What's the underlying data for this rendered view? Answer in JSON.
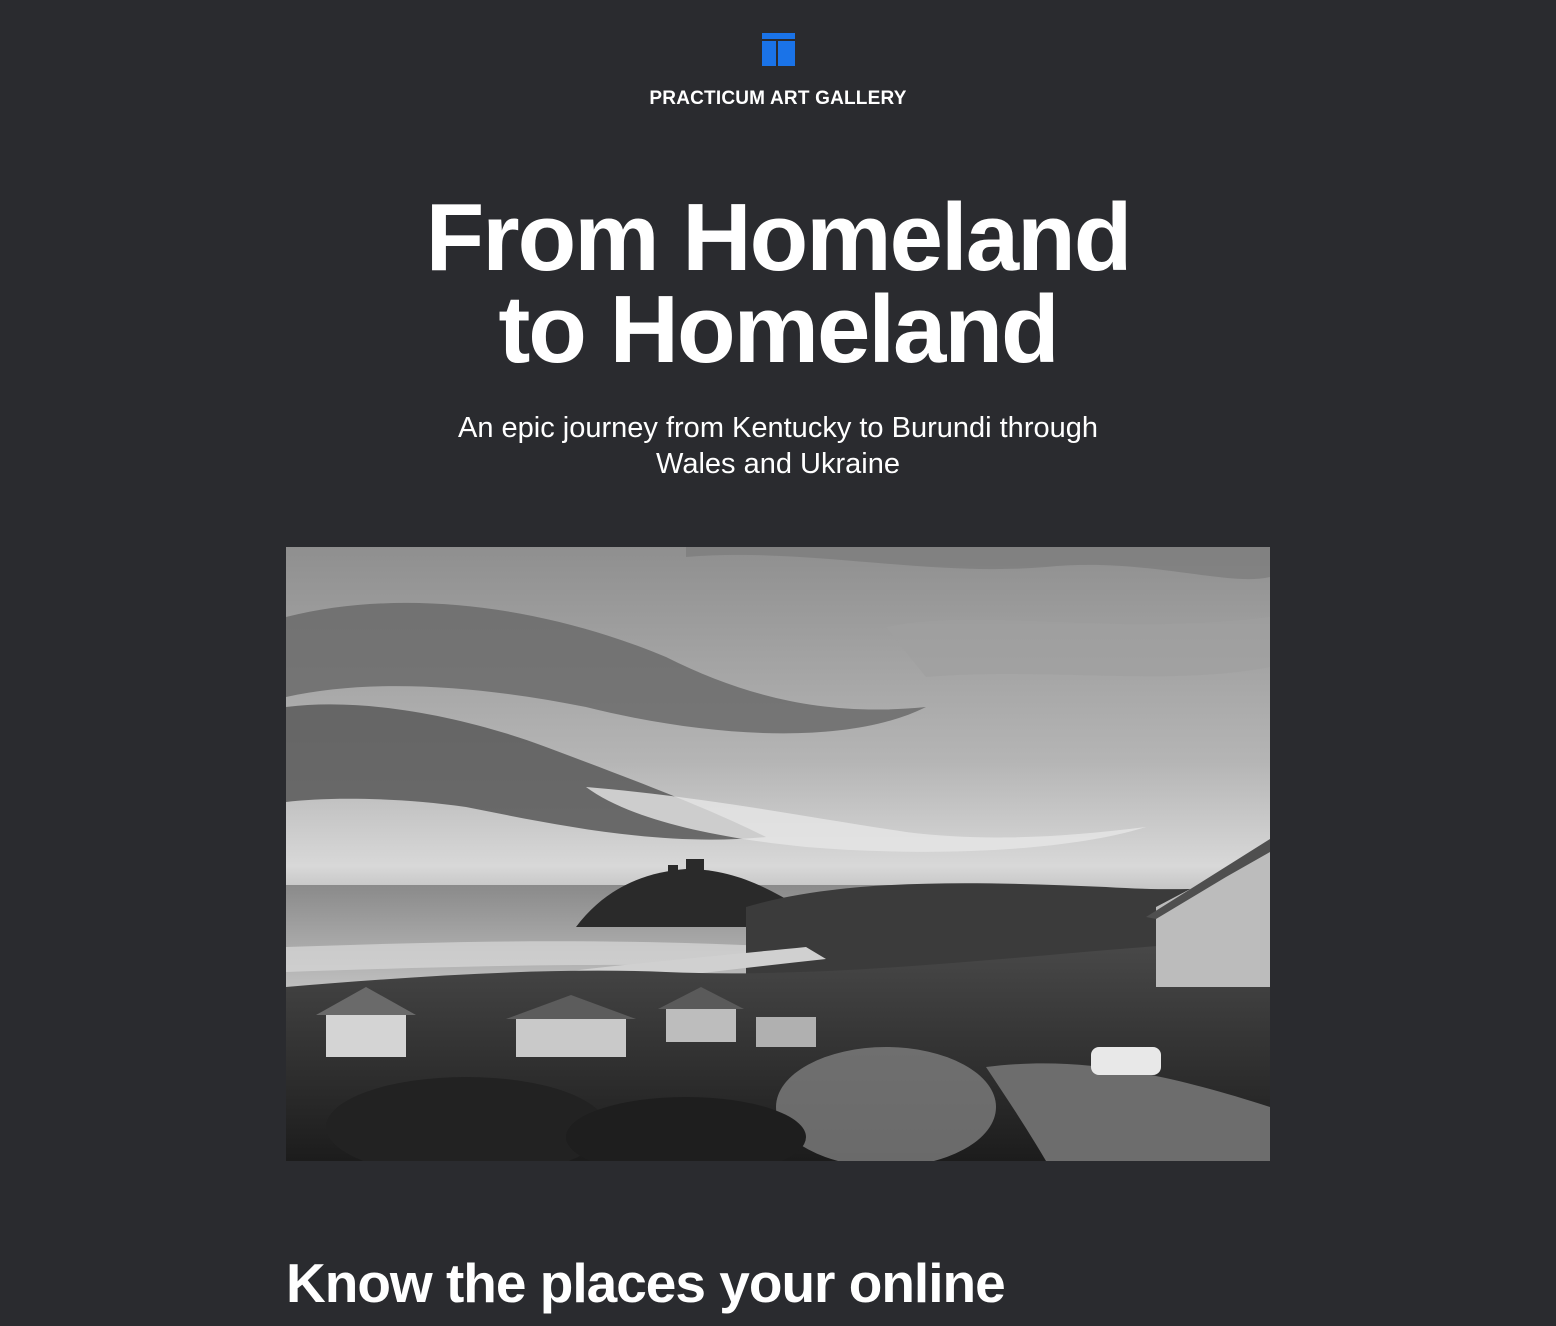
{
  "header": {
    "logo_icon": "gallery-logo-icon",
    "brand": "PRACTICUM ART GALLERY",
    "accent_color": "#1a73e8"
  },
  "hero": {
    "title_line1": "From Homeland",
    "title_line2": "to Homeland",
    "subtitle_line1": "An epic journey from Kentucky to Burundi through",
    "subtitle_line2": "Wales and Ukraine"
  },
  "photo": {
    "subject": "",
    "palette": "black-and-white"
  },
  "section": {
    "title": "Know the places your online"
  }
}
